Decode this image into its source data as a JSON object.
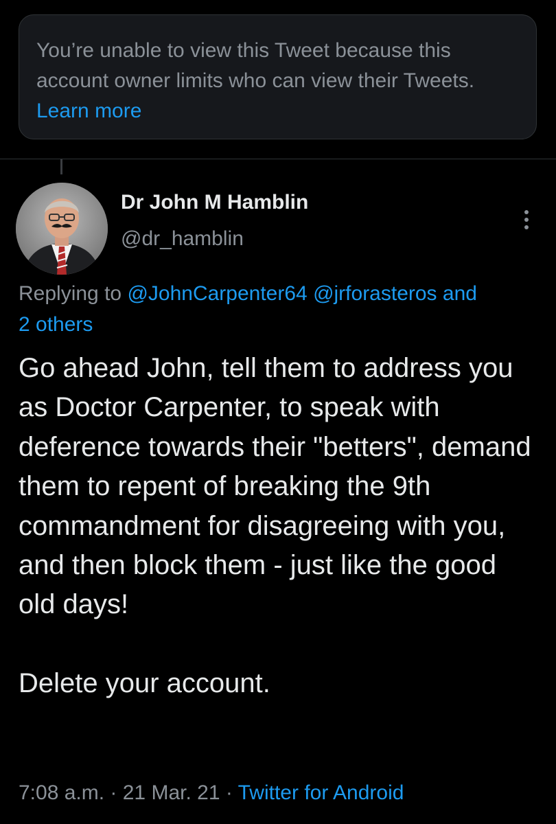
{
  "notice": {
    "text": "You’re unable to view this Tweet because this account owner limits who can view their Tweets. ",
    "link": "Learn more"
  },
  "tweet": {
    "author_name": "Dr John M Hamblin",
    "author_handle": "@dr_hamblin",
    "replying_prefix": "Replying to ",
    "replying_mention_1": "@JohnCarpenter64",
    "replying_mention_2": "@jrforasteros",
    "replying_and": " and",
    "replying_others": "2 others",
    "body": "Go ahead John, tell them to address you as Doctor Carpenter, to speak with deference towards their \"betters\", demand them to repent of breaking the 9th commandment for disagreeing with you, and then block them - just like the good old days!\n\nDelete your account.",
    "time": "7:08 a.m.",
    "sep1": " · ",
    "date": "21 Mar. 21",
    "sep2": " · ",
    "source": "Twitter for Android"
  },
  "icons": {
    "more": "more-vertical-icon",
    "avatar": "profile-photo"
  },
  "colors": {
    "background": "#000000",
    "card": "#16181c",
    "link": "#1d9bf0",
    "muted": "#8b9198",
    "text": "#e7e9ea"
  }
}
